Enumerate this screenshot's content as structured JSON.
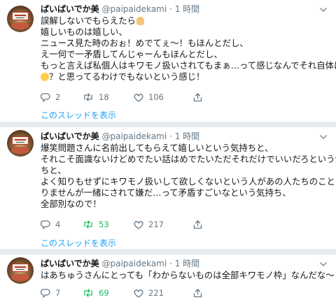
{
  "tweets": [
    {
      "name": "ぱいぱいでか美",
      "handle": "@paipaidekami",
      "sep": "·",
      "time": "1 時間",
      "lines": [
        "誤解しないでもらえたら",
        "嬉しいものは嬉しい、",
        "ニュース見た時のおぉ！めでてぇ〜！もほんとだし、",
        "え一何で一矛盾してんじゃーんもほんとだし、",
        "もっと言えば私個人はキワモノ扱いされてもまぁ…って感じなんでそれ自体にン",
        "？と思ってるわけでもないという感じ！"
      ],
      "reply_count": "2",
      "retweet_count": "18",
      "like_count": "106",
      "thread_link": "このスレッドを表示"
    },
    {
      "name": "ぱいぱいでか美",
      "handle": "@paipaidekami",
      "sep": "·",
      "time": "1 時間",
      "lines": [
        "爆笑問題さんに名前出してもらえて嬉しいという気持ちと、",
        "それこそ面識ないけどめでたい話はめでたいただそれだけでいいだろという気持",
        "ちと、",
        "よく知りもせずにキワモノ扱いして欲しくないという人があの人たちのことは知",
        "りませんが一緒にされて嫌だ…って矛盾すごいなという気持ち、",
        "全部別なので！"
      ],
      "reply_count": "4",
      "retweet_count": "53",
      "like_count": "217",
      "thread_link": "このスレッドを表示"
    },
    {
      "name": "ぱいぱいでか美",
      "handle": "@paipaidekami",
      "sep": "·",
      "time": "1 時間",
      "lines": [
        "はあちゅうさんにとっても「わからないものは全部キワモノ枠」なんだな〜"
      ],
      "reply_count": "7",
      "retweet_count": "69",
      "like_count": "221"
    }
  ],
  "colors": {
    "text": "#14171a",
    "muted": "#657786",
    "link": "#1da1f2",
    "retweet_active": "#17bf63",
    "divider": "#e6ecf0"
  },
  "icons": [
    "avatar",
    "chevron-down-icon",
    "reply-icon",
    "retweet-icon",
    "like-icon",
    "share-icon",
    "folded-hands-emoji",
    "thinking-face-emoji"
  ]
}
